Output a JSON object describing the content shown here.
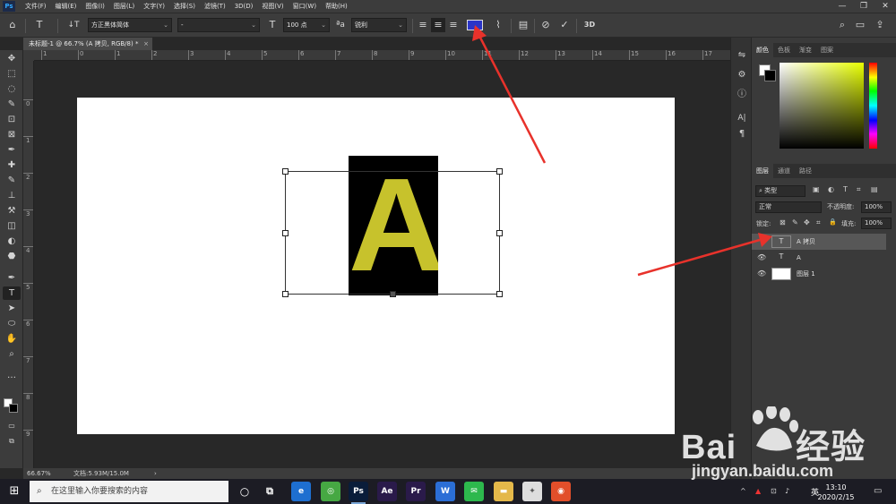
{
  "menubar": {
    "items": [
      "文件(F)",
      "编辑(E)",
      "图像(I)",
      "图层(L)",
      "文字(Y)",
      "选择(S)",
      "滤镜(T)",
      "3D(D)",
      "视图(V)",
      "窗口(W)",
      "帮助(H)"
    ],
    "app_icon": "Ps",
    "window_controls": [
      "—",
      "❐",
      "✕"
    ]
  },
  "options": {
    "home_icon": "⌂",
    "tool_icon": "T",
    "orient_icon": "↓T",
    "font_family": "方正黑体简体",
    "font_style": "-",
    "size_icon": "T",
    "font_size": "100 点",
    "aa_icon": "ªa",
    "antialias": "锐利",
    "align_left": "≡",
    "align_center": "≡",
    "align_right": "≡",
    "text_color": "#2b35c8",
    "warp_icon": "⌇",
    "panels_icon": "▤",
    "cancel_icon": "⊘",
    "commit_icon": "✓",
    "threed_label": "3D",
    "search_icon": "⌕",
    "workspace_icon": "▭",
    "share_icon": "⇪"
  },
  "document": {
    "tab_title": "未标题-1 @ 66.7% (A 拷贝, RGB/8) *",
    "close": "×",
    "glyph": "A",
    "glyph_color": "#c7c22c",
    "ruler_h": [
      "1",
      "0",
      "1",
      "2",
      "3",
      "4",
      "5",
      "6",
      "7",
      "8",
      "9",
      "10",
      "11",
      "12",
      "13",
      "14",
      "15",
      "16",
      "17"
    ],
    "ruler_v": [
      "0",
      "1",
      "2",
      "3",
      "4",
      "5",
      "6",
      "7",
      "8",
      "9"
    ]
  },
  "tools": [
    "✥",
    "⬚",
    "◌",
    "✎",
    "⊡",
    "⊠",
    "✒",
    "✚",
    "✎",
    "⊥",
    "⚒",
    "◫",
    "◐",
    "⬣",
    "✒",
    "T",
    "➤",
    "⬭",
    "✋",
    "⌕",
    "…"
  ],
  "status": {
    "zoom": "66.67%",
    "doc_info": "文档:5.93M/15.0M",
    "arrow": "›"
  },
  "iconstrip": [
    "⇋",
    "⚙",
    "ⓘ",
    "A|",
    "¶"
  ],
  "color_panel": {
    "tabs": [
      "颜色",
      "色板",
      "渐变",
      "图案"
    ]
  },
  "layers_panel": {
    "tabs": [
      "图层",
      "通道",
      "路径"
    ],
    "filter_kind": "类型",
    "filter_icons": [
      "▣",
      "◐",
      "T",
      "⌗",
      "▤"
    ],
    "blend_mode": "正常",
    "opacity_label": "不透明度:",
    "opacity_value": "100%",
    "lock_label": "锁定:",
    "lock_icons": [
      "⊠",
      "✎",
      "✥",
      "⌗",
      "🔒"
    ],
    "fill_label": "填充:",
    "fill_value": "100%",
    "layers": [
      {
        "name": "A 拷贝",
        "thumb": "T",
        "visible": false,
        "selected": true
      },
      {
        "name": "A",
        "thumb": "T",
        "visible": true,
        "selected": false
      },
      {
        "name": "图层 1",
        "thumb": "",
        "visible": true,
        "selected": false
      }
    ]
  },
  "taskbar": {
    "start_icon": "⊞",
    "search_placeholder": "在这里输入你要搜索的内容",
    "search_icon": "⌕",
    "cortana_icon": "○",
    "taskview_icon": "⧉",
    "apps": [
      {
        "label": "e",
        "color": "#1e6fd0",
        "running": false
      },
      {
        "label": "◎",
        "color": "#46a843",
        "running": false
      },
      {
        "label": "Ps",
        "color": "#0a1d3a",
        "running": true
      },
      {
        "label": "Ae",
        "color": "#2a1a4a",
        "running": false
      },
      {
        "label": "Pr",
        "color": "#2a1a4a",
        "running": false
      },
      {
        "label": "W",
        "color": "#2b6ed6",
        "running": false
      },
      {
        "label": "✉",
        "color": "#2db84d",
        "running": false
      },
      {
        "label": "▬",
        "color": "#e4b84a",
        "running": false
      },
      {
        "label": "✦",
        "color": "#dddddd",
        "running": false
      },
      {
        "label": "◉",
        "color": "#e24f2a",
        "running": false
      }
    ],
    "tray_icons": [
      "^",
      "▲",
      "⊡",
      "♪"
    ],
    "ime": "英",
    "time": "13:10",
    "date": "2020/2/15",
    "notif_icon": "▭"
  },
  "watermark": {
    "brand": "Bai",
    "brand_cn": "经验",
    "url": "jingyan.baidu.com"
  }
}
